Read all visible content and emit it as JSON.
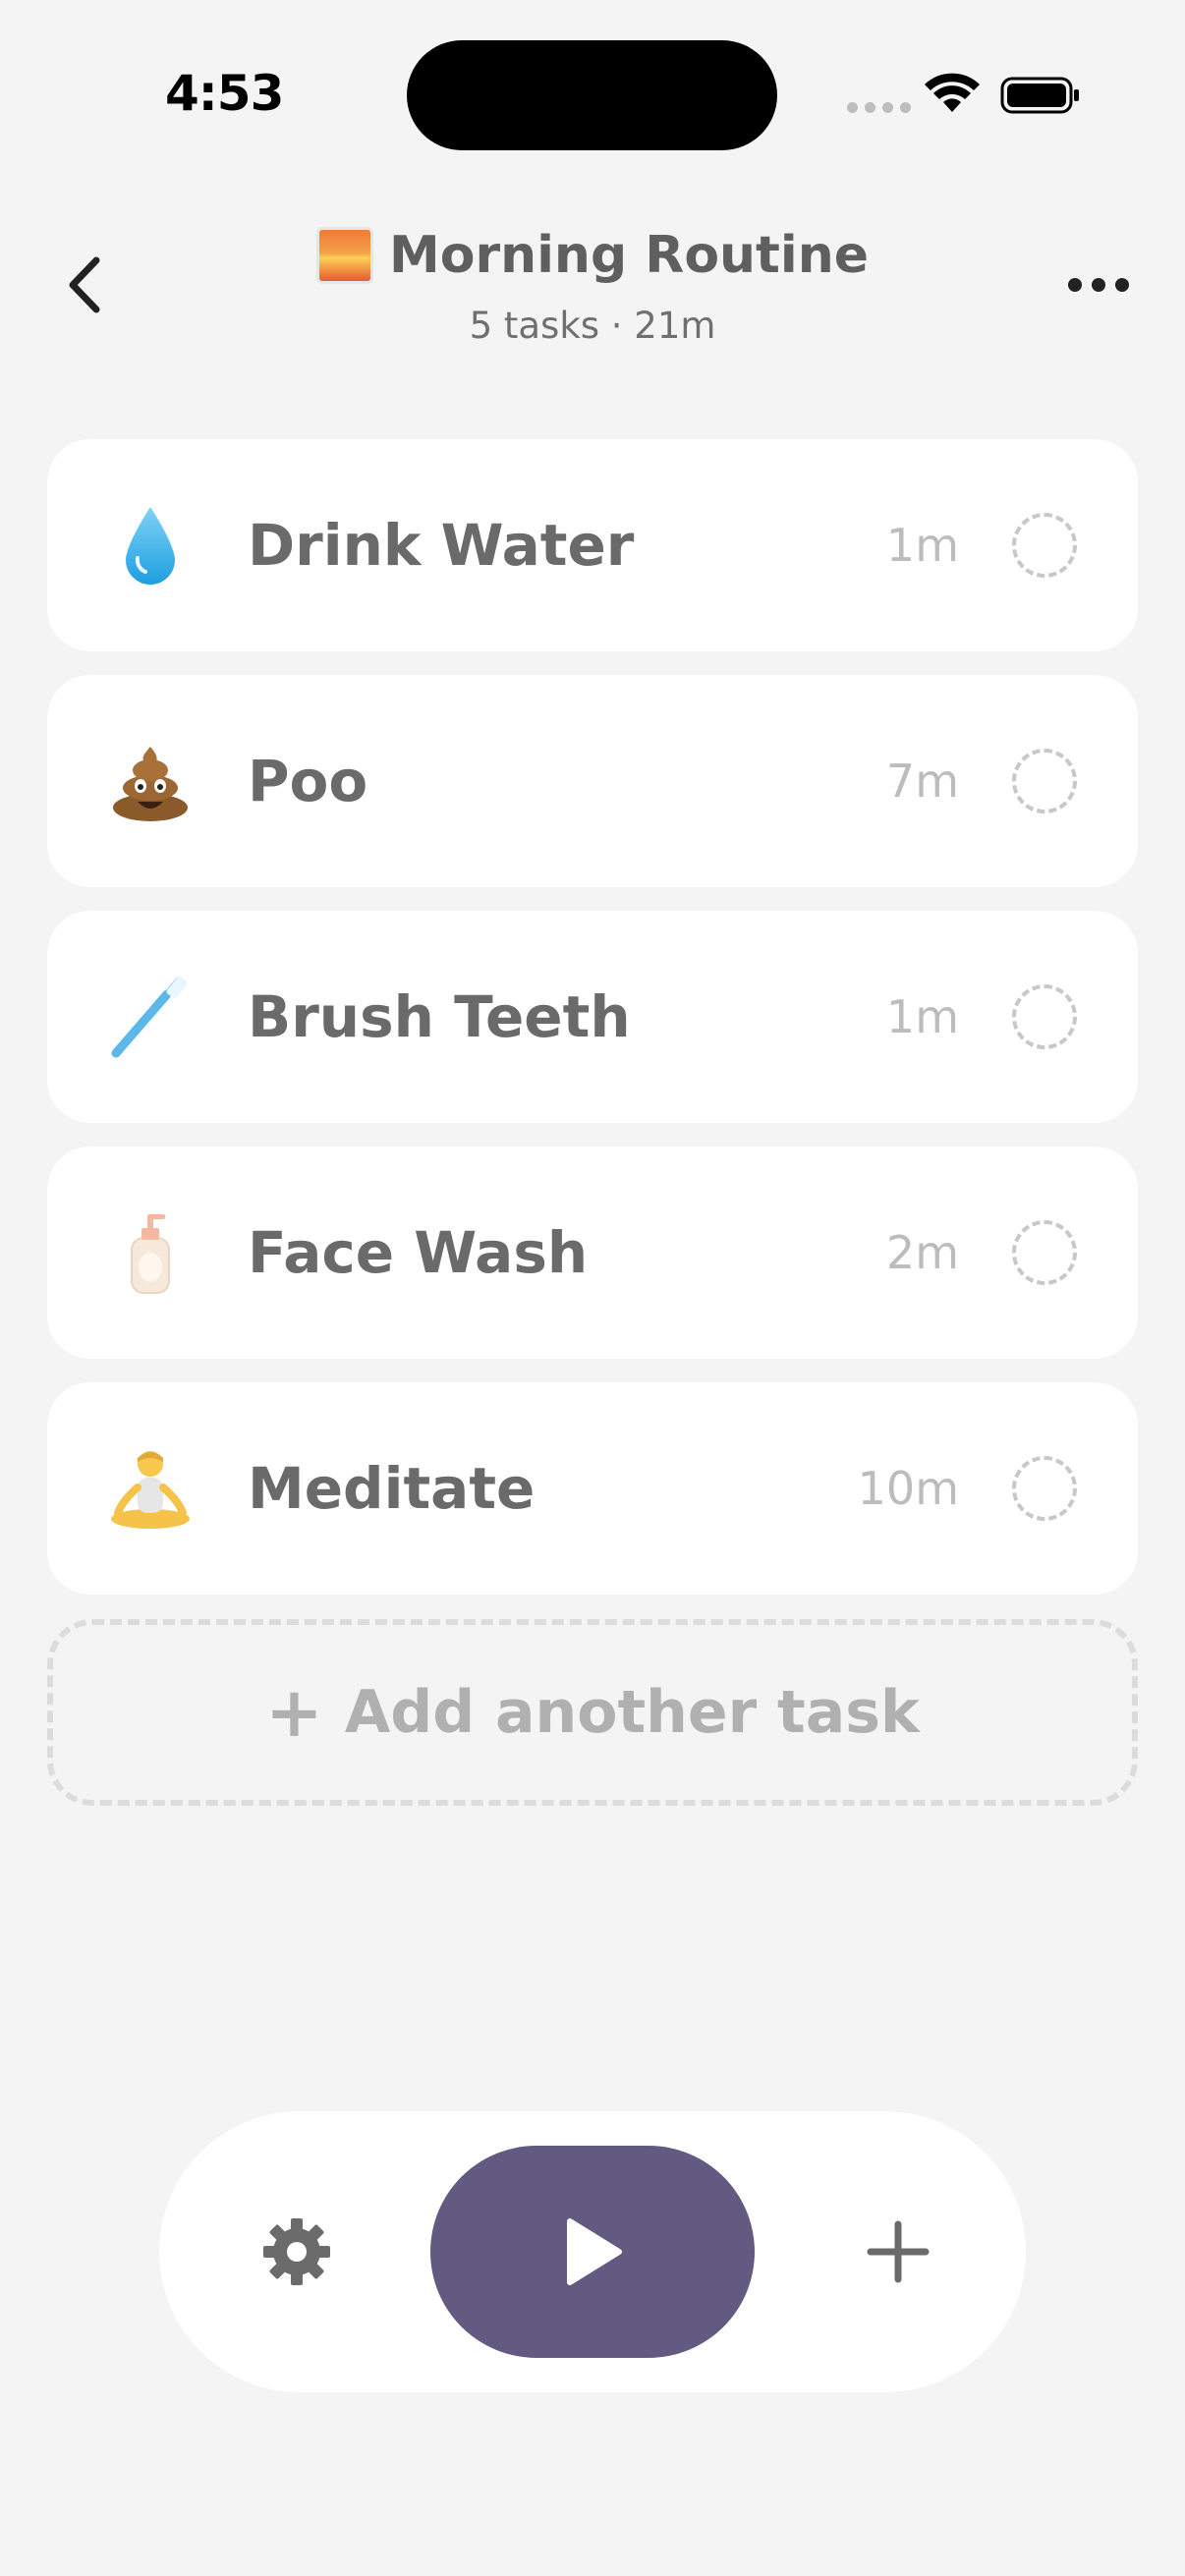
{
  "status_bar": {
    "time": "4:53"
  },
  "header": {
    "title": "Morning Routine",
    "title_emoji": "sunrise-icon",
    "subtitle": "5 tasks · 21m"
  },
  "tasks": [
    {
      "name": "Drink Water",
      "duration": "1m",
      "icon": "droplet-icon"
    },
    {
      "name": "Poo",
      "duration": "7m",
      "icon": "pile-of-poo-icon"
    },
    {
      "name": "Brush Teeth",
      "duration": "1m",
      "icon": "toothbrush-icon"
    },
    {
      "name": "Face Wash",
      "duration": "2m",
      "icon": "lotion-bottle-icon"
    },
    {
      "name": "Meditate",
      "duration": "10m",
      "icon": "meditating-person-icon"
    }
  ],
  "add_task": {
    "label": "Add another task"
  },
  "colors": {
    "accent": "#635a82",
    "background": "#f4f4f4",
    "card": "#ffffff"
  }
}
